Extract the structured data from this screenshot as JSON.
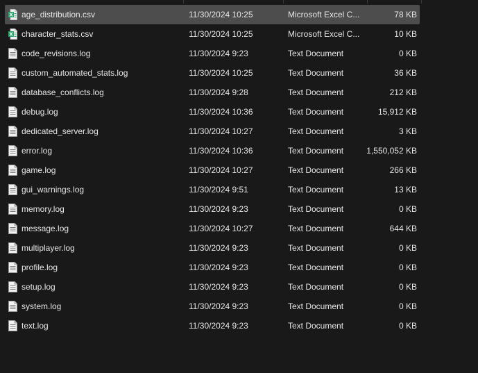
{
  "files": [
    {
      "name": "age_distribution.csv",
      "date": "11/30/2024 10:25",
      "type": "Microsoft Excel C...",
      "size": "78 KB",
      "icon": "excel-file-icon",
      "selected": true
    },
    {
      "name": "character_stats.csv",
      "date": "11/30/2024 10:25",
      "type": "Microsoft Excel C...",
      "size": "10 KB",
      "icon": "excel-file-icon"
    },
    {
      "name": "code_revisions.log",
      "date": "11/30/2024 9:23",
      "type": "Text Document",
      "size": "0 KB",
      "icon": "text-file-icon"
    },
    {
      "name": "custom_automated_stats.log",
      "date": "11/30/2024 10:25",
      "type": "Text Document",
      "size": "36 KB",
      "icon": "text-file-icon"
    },
    {
      "name": "database_conflicts.log",
      "date": "11/30/2024 9:28",
      "type": "Text Document",
      "size": "212 KB",
      "icon": "text-file-icon"
    },
    {
      "name": "debug.log",
      "date": "11/30/2024 10:36",
      "type": "Text Document",
      "size": "15,912 KB",
      "icon": "text-file-icon"
    },
    {
      "name": "dedicated_server.log",
      "date": "11/30/2024 10:27",
      "type": "Text Document",
      "size": "3 KB",
      "icon": "text-file-icon"
    },
    {
      "name": "error.log",
      "date": "11/30/2024 10:36",
      "type": "Text Document",
      "size": "1,550,052 KB",
      "icon": "text-file-icon"
    },
    {
      "name": "game.log",
      "date": "11/30/2024 10:27",
      "type": "Text Document",
      "size": "266 KB",
      "icon": "text-file-icon"
    },
    {
      "name": "gui_warnings.log",
      "date": "11/30/2024 9:51",
      "type": "Text Document",
      "size": "13 KB",
      "icon": "text-file-icon"
    },
    {
      "name": "memory.log",
      "date": "11/30/2024 9:23",
      "type": "Text Document",
      "size": "0 KB",
      "icon": "text-file-icon"
    },
    {
      "name": "message.log",
      "date": "11/30/2024 10:27",
      "type": "Text Document",
      "size": "644 KB",
      "icon": "text-file-icon"
    },
    {
      "name": "multiplayer.log",
      "date": "11/30/2024 9:23",
      "type": "Text Document",
      "size": "0 KB",
      "icon": "text-file-icon"
    },
    {
      "name": "profile.log",
      "date": "11/30/2024 9:23",
      "type": "Text Document",
      "size": "0 KB",
      "icon": "text-file-icon"
    },
    {
      "name": "setup.log",
      "date": "11/30/2024 9:23",
      "type": "Text Document",
      "size": "0 KB",
      "icon": "text-file-icon"
    },
    {
      "name": "system.log",
      "date": "11/30/2024 9:23",
      "type": "Text Document",
      "size": "0 KB",
      "icon": "text-file-icon"
    },
    {
      "name": "text.log",
      "date": "11/30/2024 9:23",
      "type": "Text Document",
      "size": "0 KB",
      "icon": "text-file-icon"
    }
  ],
  "colors": {
    "background": "#191919",
    "selected_row": "#4d4d4d",
    "text": "#e6e6e6",
    "excel_green": "#21a366"
  }
}
